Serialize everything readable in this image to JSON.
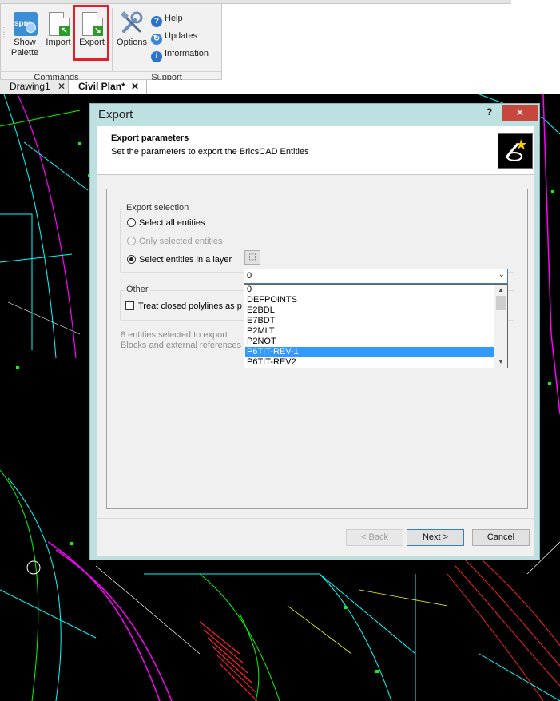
{
  "ribbon": {
    "buttons": {
      "show_palette": "Show\nPalette",
      "show_palette_icon_text": "spm",
      "import": "Import",
      "export": "Export",
      "options": "Options"
    },
    "support_links": {
      "help": "Help",
      "updates": "Updates",
      "information": "Information"
    },
    "groups": {
      "commands": "Commands",
      "support": "Support"
    },
    "highlight_color": "#e21f26"
  },
  "tabs": [
    {
      "label": "Drawing1",
      "active": false
    },
    {
      "label": "Civil Plan*",
      "active": true
    }
  ],
  "dialog": {
    "title": "Export",
    "help_glyph": "?",
    "close_glyph": "✕",
    "header": {
      "title": "Export parameters",
      "subtitle": "Set the parameters to export the BricsCAD Entities"
    },
    "export_selection": {
      "legend": "Export selection",
      "select_all": "Select all entities",
      "only_selected": "Only selected entities",
      "select_in_layer": "Select entities in a layer",
      "selected_option": "select_in_layer",
      "layer_value": "0"
    },
    "layer_options": [
      "0",
      "DEFPOINTS",
      "E2BDL",
      "E7BDT",
      "P2MLT",
      "P2NOT",
      "P6TIT-REV-1",
      "P6TIT-REV2"
    ],
    "highlighted_layer": "P6TIT-REV-1",
    "other": {
      "legend": "Other",
      "treat_closed": "Treat closed polylines as p",
      "treat_closed_checked": false
    },
    "info": {
      "line1": "8 entities selected to export",
      "line2": "Blocks and external references in"
    },
    "buttons": {
      "back": "< Back",
      "next": "Next >",
      "cancel": "Cancel"
    }
  }
}
